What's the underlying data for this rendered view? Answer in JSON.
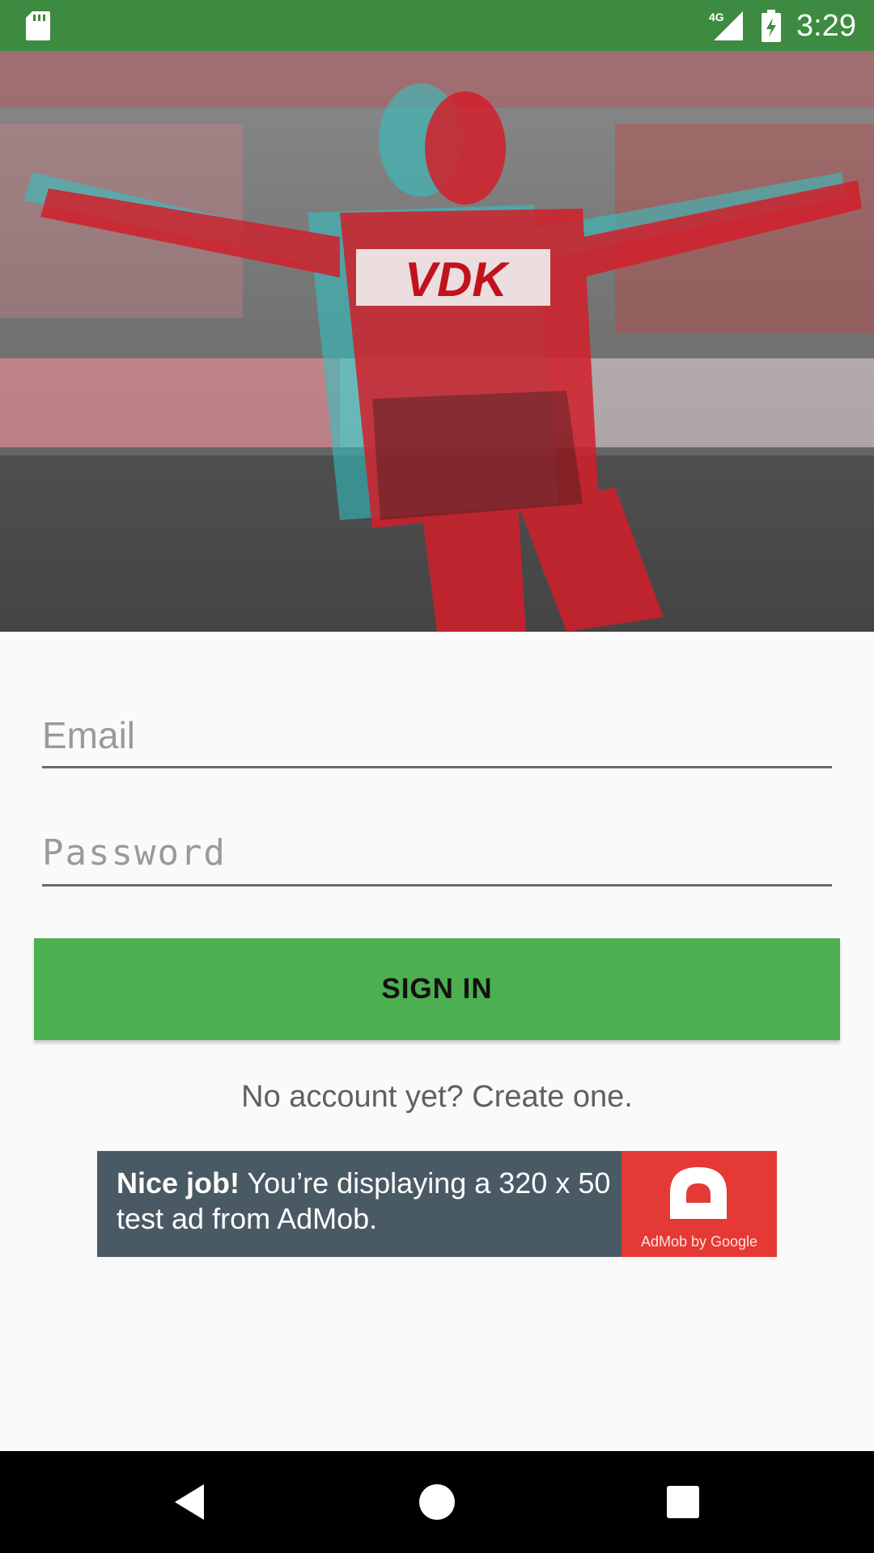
{
  "status_bar": {
    "time": "3:29",
    "network_label": "4G",
    "icons": [
      "sd-card-icon",
      "signal-icon",
      "battery-icon"
    ],
    "background_color": "#3d8b40"
  },
  "hero": {
    "description_icon": "football-player-celebration-image",
    "shirt_text": "VDK"
  },
  "login_form": {
    "email_placeholder": "Email",
    "email_value": "",
    "password_placeholder": "Password",
    "password_value": "",
    "sign_in_label": "SIGN IN",
    "create_account_text": "No account yet? Create one."
  },
  "ad": {
    "headline_bold": "Nice job!",
    "body_text": " You’re displaying a 320 x 50 test ad from AdMob.",
    "brand_label": "AdMob by Google",
    "icon": "admob-logo-icon"
  },
  "nav_bar": {
    "icons": [
      "back-icon",
      "home-icon",
      "recents-icon"
    ]
  },
  "colors": {
    "accent_green": "#4caf50",
    "status_green": "#3d8b40",
    "ad_background": "#4a5a64",
    "ad_logo_red": "#e53935"
  }
}
